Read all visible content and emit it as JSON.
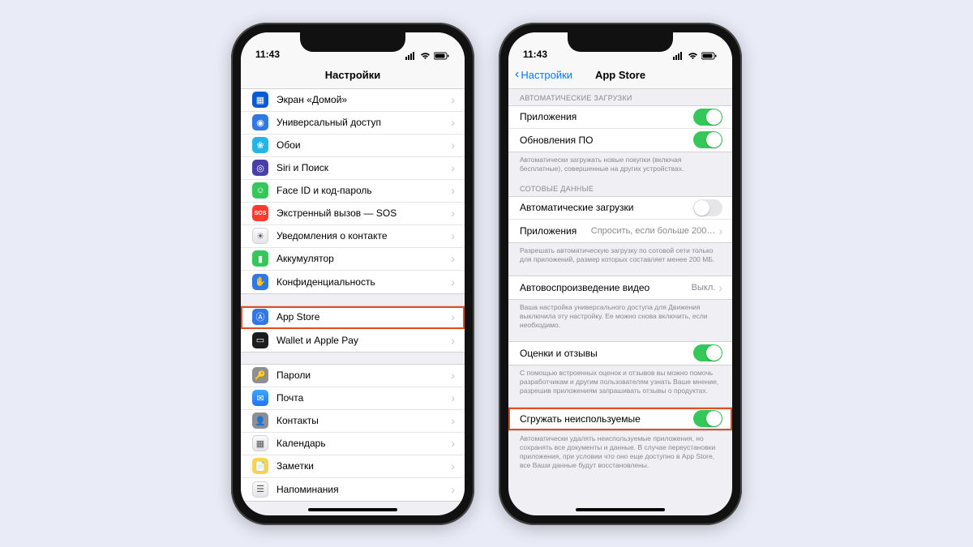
{
  "statusTime": "11:43",
  "left": {
    "title": "Настройки",
    "group1": [
      {
        "icon": "home-icon",
        "bg": "bg-blue2",
        "label": "Экран «Домой»"
      },
      {
        "icon": "accessibility-icon",
        "bg": "bg-blue",
        "label": "Универсальный доступ"
      },
      {
        "icon": "wallpaper-icon",
        "bg": "bg-cyan",
        "label": "Обои"
      },
      {
        "icon": "siri-icon",
        "bg": "bg-purple",
        "label": "Siri и Поиск"
      },
      {
        "icon": "faceid-icon",
        "bg": "bg-green",
        "label": "Face ID и код-пароль"
      },
      {
        "icon": "sos-icon",
        "bg": "bg-red",
        "label": "Экстренный вызов — SOS"
      },
      {
        "icon": "exposure-icon",
        "bg": "bg-white",
        "label": "Уведомления о контакте"
      },
      {
        "icon": "battery-icon",
        "bg": "bg-green",
        "label": "Аккумулятор"
      },
      {
        "icon": "privacy-icon",
        "bg": "bg-blue",
        "label": "Конфиденциальность"
      }
    ],
    "group2": [
      {
        "icon": "appstore-icon",
        "bg": "bg-blue",
        "label": "App Store",
        "highlight": true
      },
      {
        "icon": "wallet-icon",
        "bg": "bg-black",
        "label": "Wallet и Apple Pay"
      }
    ],
    "group3": [
      {
        "icon": "passwords-icon",
        "bg": "bg-gray",
        "label": "Пароли"
      },
      {
        "icon": "mail-icon",
        "bg": "bg-mail",
        "label": "Почта"
      },
      {
        "icon": "contacts-icon",
        "bg": "bg-gray",
        "label": "Контакты"
      },
      {
        "icon": "calendar-icon",
        "bg": "bg-white",
        "label": "Календарь"
      },
      {
        "icon": "notes-icon",
        "bg": "bg-yellow",
        "label": "Заметки"
      },
      {
        "icon": "reminders-icon",
        "bg": "bg-white",
        "label": "Напоминания"
      }
    ]
  },
  "right": {
    "back": "Настройки",
    "title": "App Store",
    "section1": {
      "header": "АВТОМАТИЧЕСКИЕ ЗАГРУЗКИ",
      "rows": [
        {
          "label": "Приложения",
          "toggle": true
        },
        {
          "label": "Обновления ПО",
          "toggle": true
        }
      ],
      "footer": "Автоматически загружать новые покупки (включая бесплатные), совершенные на других устройствах."
    },
    "section2": {
      "header": "СОТОВЫЕ ДАННЫЕ",
      "rows": [
        {
          "label": "Автоматические загрузки",
          "toggle": false
        },
        {
          "label": "Приложения",
          "value": "Спросить, если больше 200…",
          "chevron": true
        }
      ],
      "footer": "Разрешать автоматическую загрузку по сотовой сети только для приложений, размер которых составляет менее 200 МБ."
    },
    "section3": {
      "rows": [
        {
          "label": "Автовоспроизведение видео",
          "value": "Выкл.",
          "chevron": true
        }
      ],
      "footer": "Ваша настройка универсального доступа для Движения выключила эту настройку. Ее можно снова включить, если необходимо."
    },
    "section4": {
      "rows": [
        {
          "label": "Оценки и отзывы",
          "toggle": true
        }
      ],
      "footer": "С помощью встроенных оценок и отзывов вы можно помочь разработчикам и другим пользователям узнать Ваше мнение, разрешив приложениям запрашивать отзывы о продуктах."
    },
    "section5": {
      "rows": [
        {
          "label": "Сгружать неиспользуемые",
          "toggle": true,
          "highlight": true
        }
      ],
      "footer": "Автоматически удалять неиспользуемые приложения, но сохранять все документы и данные. В случае переустановки приложения, при условии что оно еще доступно в App Store, все Ваши данные будут восстановлены."
    }
  }
}
